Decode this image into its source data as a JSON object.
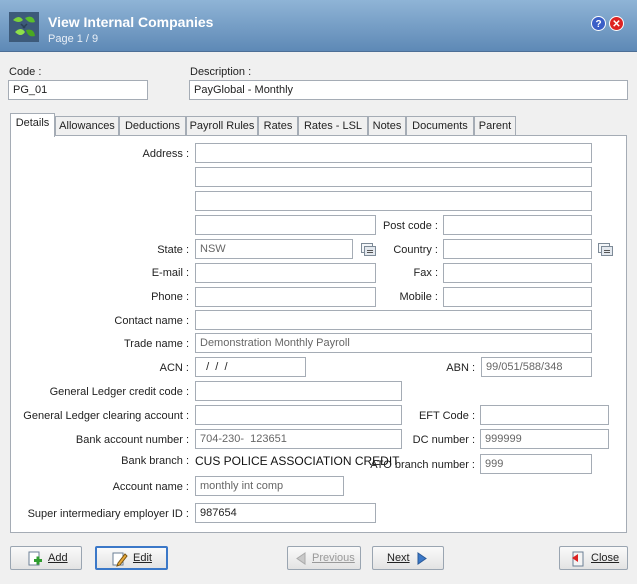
{
  "window": {
    "title": "View Internal Companies",
    "subtitle": "Page 1 / 9",
    "help_glyph": "?",
    "close_glyph": "✕"
  },
  "header": {
    "code_label": "Code :",
    "code_value": "PG_01",
    "description_label": "Description :",
    "description_value": "PayGlobal - Monthly"
  },
  "tabs": [
    "Details",
    "Allowances",
    "Deductions",
    "Payroll Rules",
    "Rates",
    "Rates - LSL",
    "Notes",
    "Documents",
    "Parent"
  ],
  "details": {
    "address_label": "Address :",
    "address_lines": [
      "",
      "",
      "",
      ""
    ],
    "postcode_label": "Post code :",
    "postcode_value": "",
    "state_label": "State :",
    "state_value": "NSW",
    "country_label": "Country :",
    "country_value": "",
    "email_label": "E-mail :",
    "email_value": "",
    "fax_label": "Fax :",
    "fax_value": "",
    "phone_label": "Phone :",
    "phone_value": "",
    "mobile_label": "Mobile :",
    "mobile_value": "",
    "contact_label": "Contact name :",
    "contact_value": "",
    "trade_label": "Trade name :",
    "trade_value": "Demonstration Monthly Payroll",
    "acn_label": "ACN :",
    "acn_value": "  /  /  /",
    "abn_label": "ABN :",
    "abn_value": "99/051/588/348",
    "gl_credit_label": "General Ledger credit code :",
    "gl_credit_value": "",
    "gl_clearing_label": "General Ledger clearing account :",
    "gl_clearing_value": "",
    "eft_label": "EFT Code :",
    "eft_value": "",
    "bank_account_label": "Bank account number :",
    "bank_account_value": "704-230-  123651",
    "dc_label": "DC number :",
    "dc_value": "999999",
    "bank_branch_label": "Bank branch :",
    "bank_branch_value": "CUS POLICE ASSOCIATION CREDIT",
    "ato_label": "ATO branch number :",
    "ato_value": "999",
    "account_name_label": "Account name :",
    "account_name_value": "monthly int comp",
    "super_label": "Super intermediary employer ID :",
    "super_value": "987654"
  },
  "buttons": {
    "add": "Add",
    "edit": "Edit",
    "previous": "Previous",
    "next": "Next",
    "close": "Close"
  },
  "colors": {
    "titlebar": "#6e96c2",
    "accent": "#3b78c8",
    "close_red": "#d22222"
  }
}
